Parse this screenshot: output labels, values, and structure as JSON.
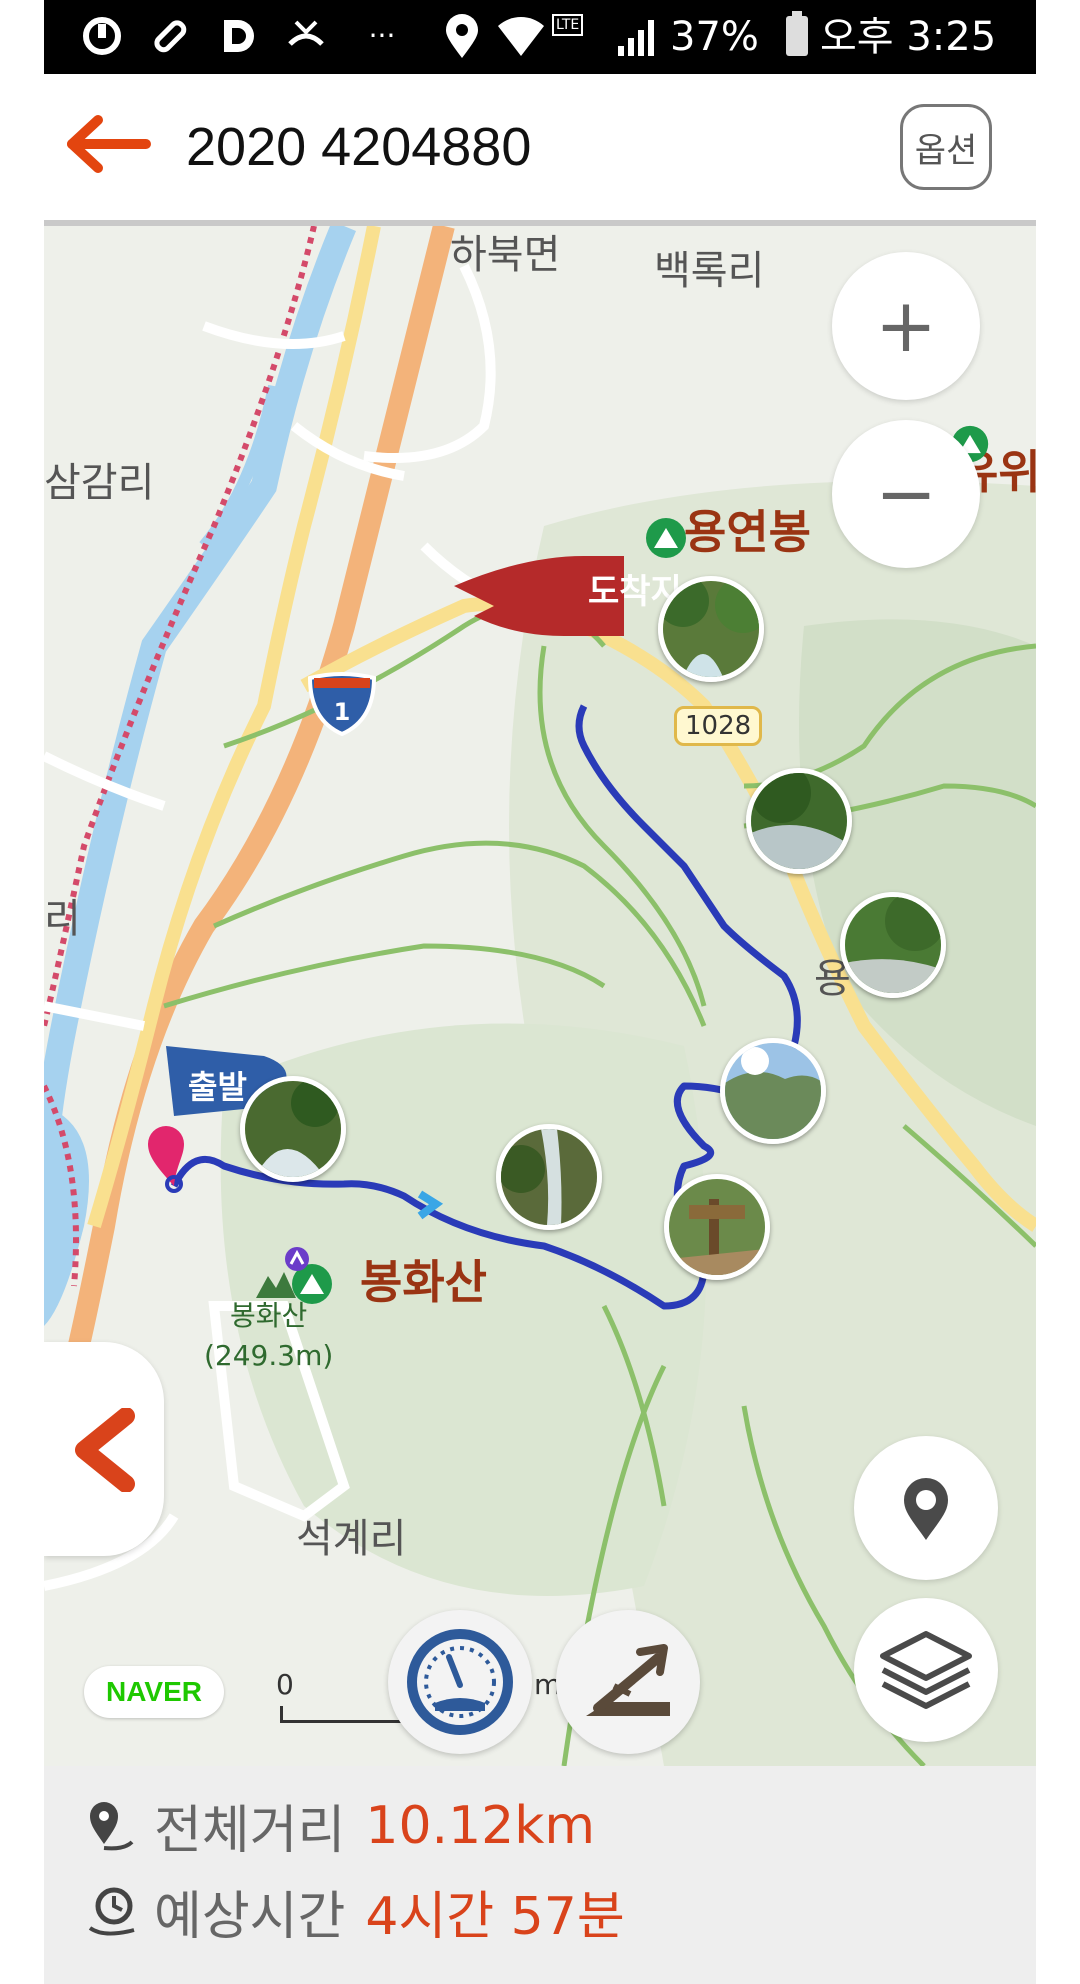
{
  "status_bar": {
    "battery": "37%",
    "time": "오후 3:25",
    "more": "···",
    "lte": "LTE"
  },
  "header": {
    "title": "2020 4204880",
    "option_label": "옵션"
  },
  "map": {
    "places": {
      "north_town": "하북면",
      "northeast_village": "백록리",
      "west_village": "삼감리",
      "cut_right": "유위",
      "cut_mid": "용",
      "south_village": "석계리",
      "cut_left": "리"
    },
    "peaks": {
      "arrival_peak": "용연봉",
      "start_peak": "봉화산",
      "small_peak_name": "봉화산",
      "small_peak_height": "(249.3m)"
    },
    "flags": {
      "arrival": "도착지",
      "start": "출발"
    },
    "road_signs": {
      "highway": "1",
      "local_road": "1028"
    },
    "zoom_in": "+",
    "zoom_out": "−",
    "scale_zero": "0",
    "scale_unit": "m",
    "naver": "NAVER"
  },
  "footer": {
    "distance_label": "전체거리",
    "distance_value": "10.12km",
    "time_label": "예상시간",
    "time_value": "4시간 57분"
  },
  "colors": {
    "accent": "#d9431b",
    "route": "#2a3bb8",
    "arrival_flag": "#b52a2a",
    "start_flag": "#2f5ea8"
  }
}
